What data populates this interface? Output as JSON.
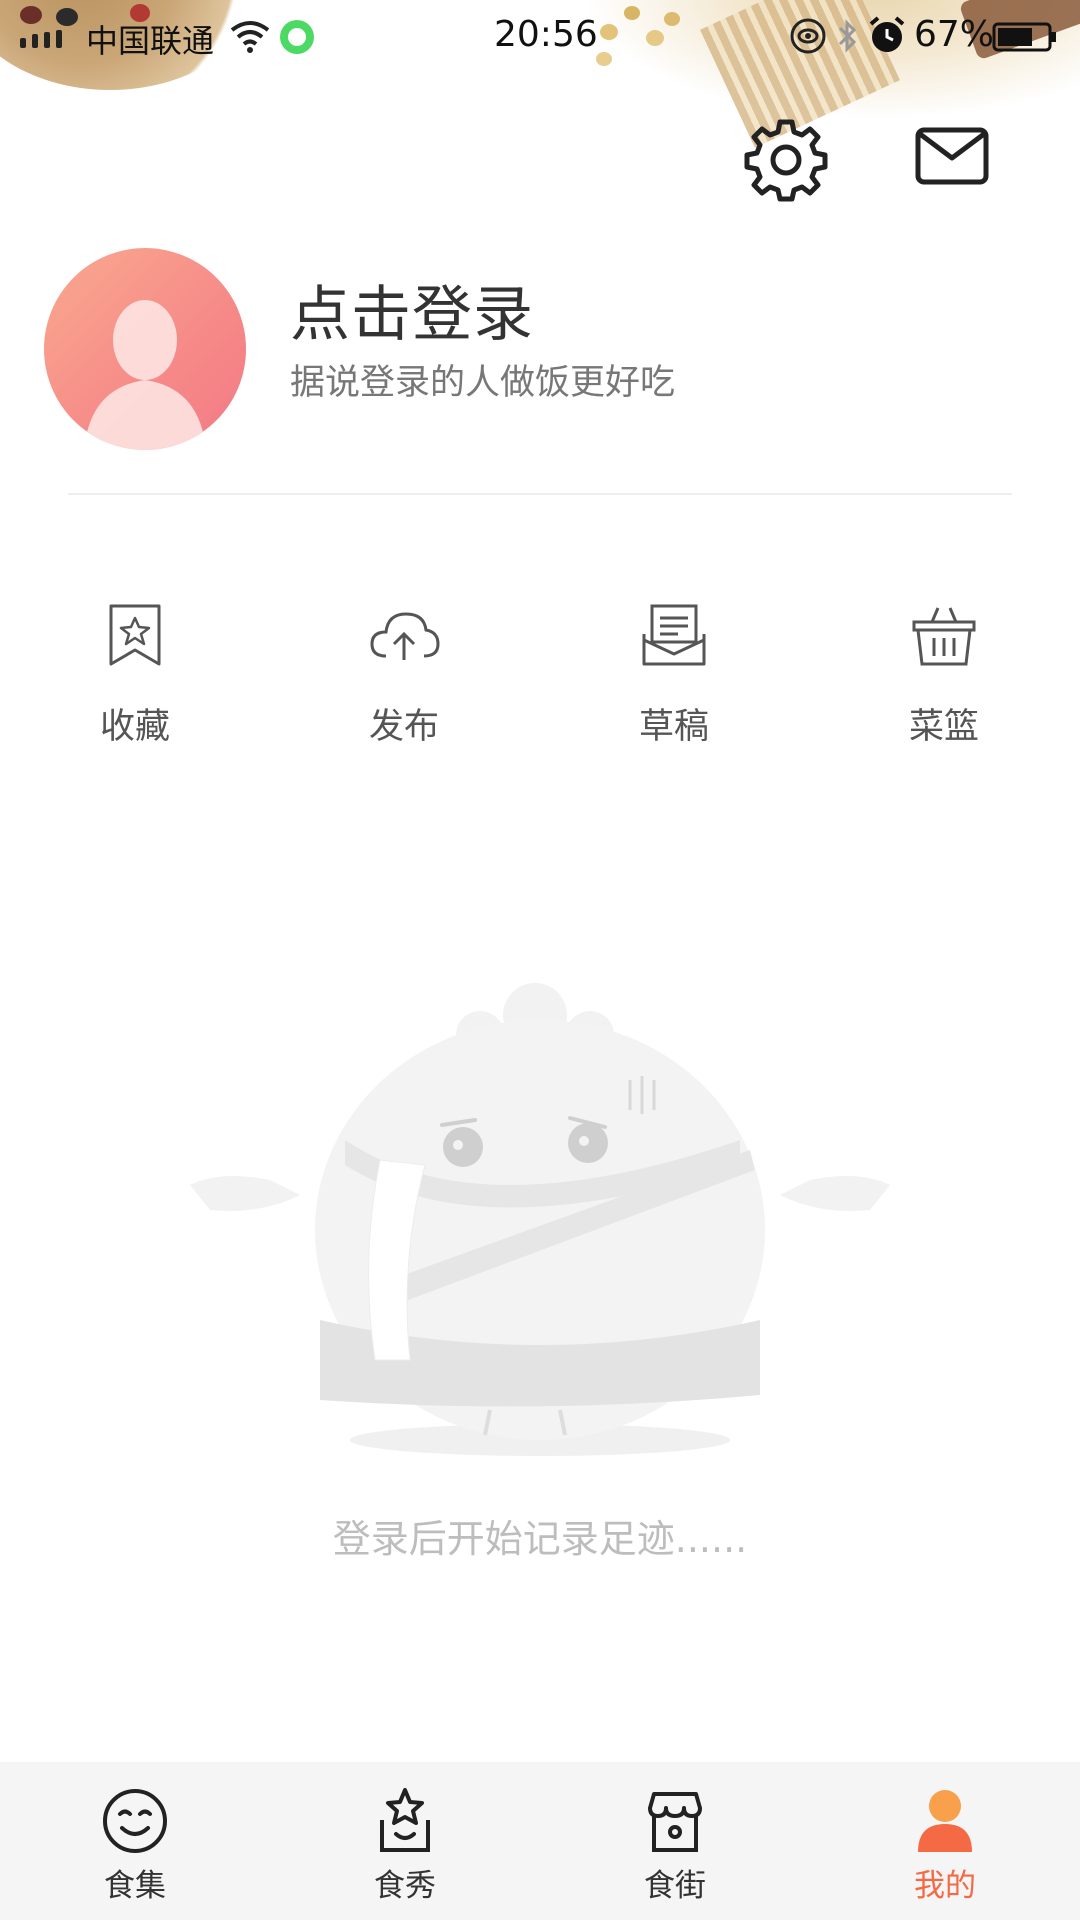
{
  "status_bar": {
    "carrier": "中国联通",
    "time": "20:56",
    "battery": "67%",
    "icons": [
      "signal-icon",
      "wifi-icon",
      "wechat-icon",
      "eye-icon",
      "bluetooth-icon",
      "alarm-icon",
      "battery-icon"
    ]
  },
  "header": {
    "icons": [
      "gear-icon",
      "mail-icon"
    ]
  },
  "profile": {
    "title": "点击登录",
    "subtitle": "据说登录的人做饭更好吃",
    "avatar_icon": "default-avatar-icon",
    "avatar_color": "#f68a88"
  },
  "actions": [
    {
      "label": "收藏",
      "icon": "bookmark-star-icon"
    },
    {
      "label": "发布",
      "icon": "cloud-upload-icon"
    },
    {
      "label": "草稿",
      "icon": "draft-envelope-icon"
    },
    {
      "label": "菜篮",
      "icon": "basket-icon"
    }
  ],
  "empty_state": {
    "text": "登录后开始记录足迹......",
    "illustration": "dumpling-mascot-icon"
  },
  "bottom_nav": {
    "items": [
      {
        "label": "食集",
        "icon": "smiley-icon",
        "active": false
      },
      {
        "label": "食秀",
        "icon": "star-bag-icon",
        "active": false
      },
      {
        "label": "食街",
        "icon": "shop-icon",
        "active": false
      },
      {
        "label": "我的",
        "icon": "user-icon",
        "active": true
      }
    ],
    "active_color": "#f46a44"
  },
  "colors": {
    "accent": "#f46a44",
    "text_primary": "#333333",
    "text_secondary": "#777777",
    "empty_text": "#bdbdbd",
    "nav_bg": "#f5f5f5"
  }
}
